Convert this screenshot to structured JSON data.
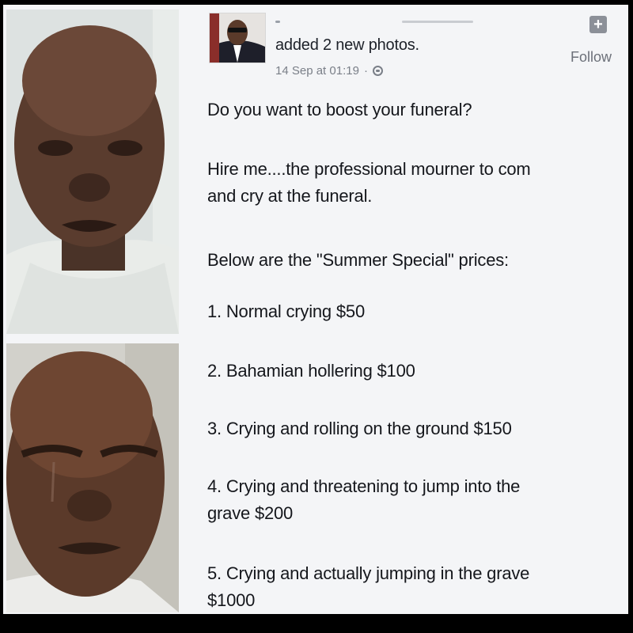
{
  "post": {
    "action": "added 2 new photos.",
    "timestamp": "14 Sep at 01:19",
    "separator": "·",
    "follow": "Follow",
    "plus": "+",
    "intro": "Do you want to boost your funeral?",
    "hire_line1": "Hire me....the professional mourner to com",
    "hire_line2": "and cry at the funeral.",
    "prices_intro": "Below are the \"Summer Special\"  prices:",
    "items": [
      "1. Normal crying $50",
      "2. Bahamian hollering $100",
      "3. Crying and rolling on the ground $150",
      "4. Crying and threatening to jump into the",
      "grave $200",
      "5. Crying and actually jumping in the grave",
      "$1000"
    ]
  },
  "colors": {
    "background": "#f4f5f7",
    "text": "#15171c",
    "meta": "#7a7f88",
    "frame": "#000000"
  },
  "icons": [
    "globe-icon",
    "plus-icon"
  ]
}
